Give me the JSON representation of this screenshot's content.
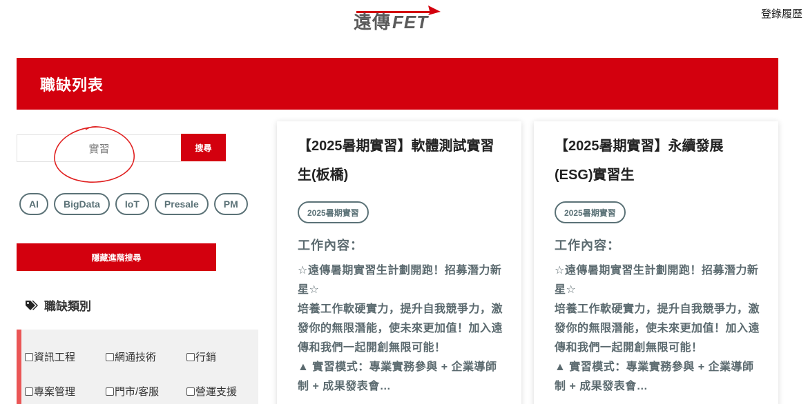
{
  "header": {
    "logo_cn": "遠傳",
    "logo_en": "FET",
    "login_link": "登錄履歷"
  },
  "banner": {
    "title": "職缺列表"
  },
  "search": {
    "value": "實習",
    "button_label": "搜尋"
  },
  "tags": [
    "AI",
    "BigData",
    "IoT",
    "Presale",
    "PM"
  ],
  "advanced": {
    "button_label": "隱藏進階搜尋"
  },
  "categories": {
    "title": "職缺類別",
    "items": [
      "資訊工程",
      "網通技術",
      "行銷",
      "專案管理",
      "門市/客服",
      "營運支援"
    ]
  },
  "jobs": [
    {
      "title": "【2025暑期實習】軟體測試實習生(板橋)",
      "badge": "2025暑期實習",
      "section": "工作內容：",
      "desc": [
        "☆遠傳暑期實習生計劃開跑！招募潛力新星☆",
        "培養工作軟硬實力，提升自我競爭力，激發你的無限潛能，使未來更加值！加入遠傳和我們一起開創無限可能！",
        "▲ 實習模式：專業實務參與 + 企業導師制 + 成果發表會…"
      ]
    },
    {
      "title": "【2025暑期實習】永續發展(ESG)實習生",
      "badge": "2025暑期實習",
      "section": "工作內容：",
      "desc": [
        "☆遠傳暑期實習生計劃開跑！招募潛力新星☆",
        "培養工作軟硬實力，提升自我競爭力，激發你的無限潛能，使未來更加值！加入遠傳和我們一起開創無限可能！",
        "▲ 實習模式：專業實務參與 + 企業導師制 + 成果發表會…"
      ]
    }
  ],
  "colors": {
    "brand_red": "#d3000e",
    "tag_border": "#5b7277",
    "category_accent": "#ea5656"
  }
}
